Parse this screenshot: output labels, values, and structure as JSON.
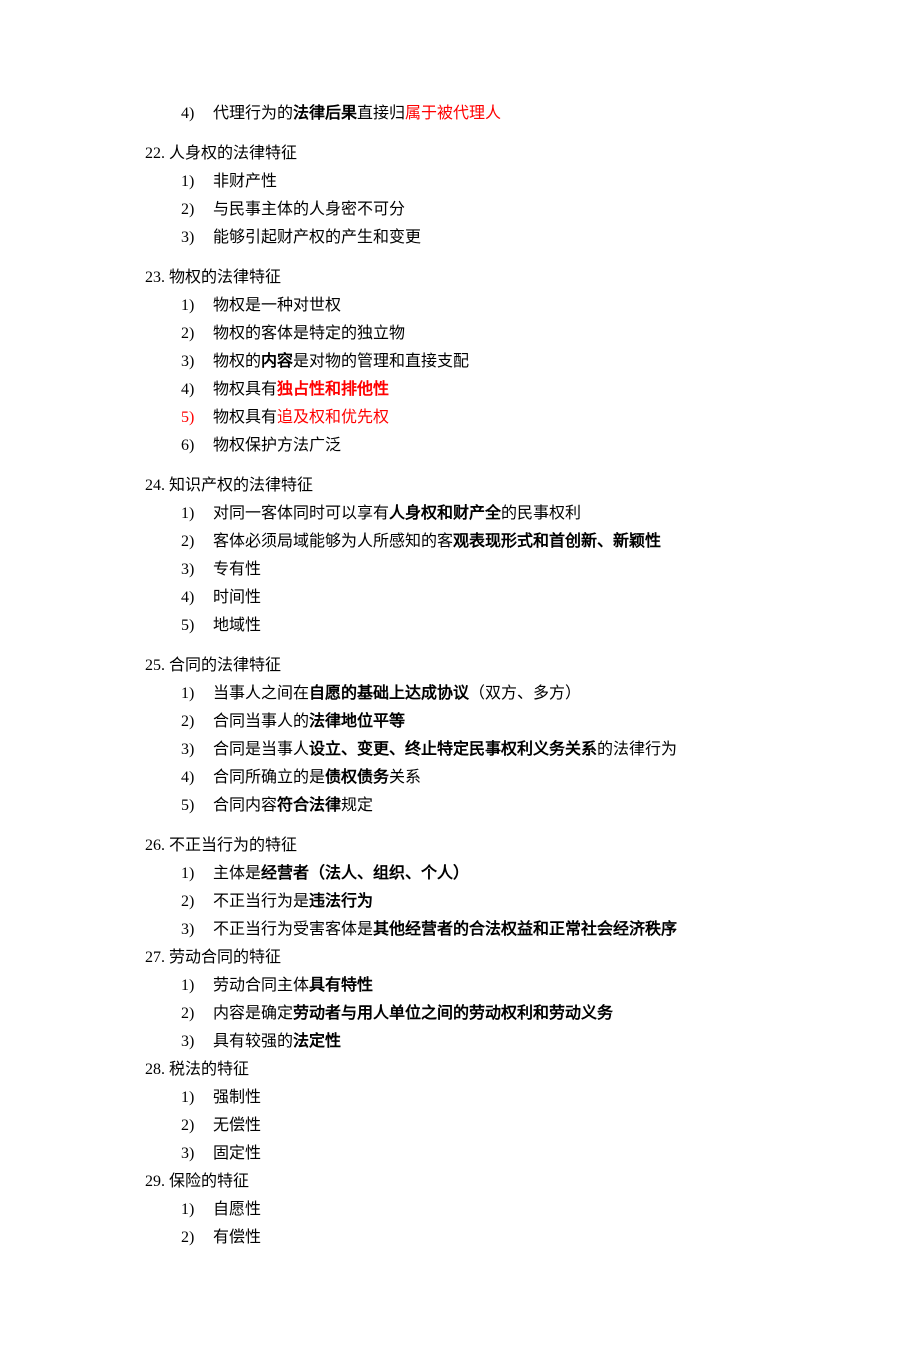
{
  "prefix": {
    "marker": "4)",
    "parts": [
      {
        "text": "代理行为的",
        "class": ""
      },
      {
        "text": "法律后果",
        "class": "bold"
      },
      {
        "text": "直接归",
        "class": ""
      },
      {
        "text": "属于被代理人",
        "class": "red"
      }
    ]
  },
  "sections": [
    {
      "num": "22.",
      "title": "人身权的法律特征",
      "title_class": "",
      "items": [
        {
          "marker": "1)",
          "parts": [
            {
              "text": "非财产性",
              "class": ""
            }
          ]
        },
        {
          "marker": "2)",
          "parts": [
            {
              "text": "与民事主体的人身密不可分",
              "class": ""
            }
          ]
        },
        {
          "marker": "3)",
          "parts": [
            {
              "text": "能够引起财产权的产生和变更",
              "class": ""
            }
          ]
        }
      ],
      "spaced": true
    },
    {
      "num": "23.",
      "title": "物权的法律特征",
      "title_class": "",
      "items": [
        {
          "marker": "1)",
          "parts": [
            {
              "text": "物权是一种对世权",
              "class": ""
            }
          ]
        },
        {
          "marker": "2)",
          "parts": [
            {
              "text": "物权的客体是特定的独立物",
              "class": ""
            }
          ]
        },
        {
          "marker": "3)",
          "parts": [
            {
              "text": "物权的",
              "class": ""
            },
            {
              "text": "内容",
              "class": "bold"
            },
            {
              "text": "是对物的管理和直接支配",
              "class": ""
            }
          ]
        },
        {
          "marker": "4)",
          "parts": [
            {
              "text": "物权具有",
              "class": ""
            },
            {
              "text": "独占性和排他性",
              "class": "bold red"
            }
          ]
        },
        {
          "marker": "5)",
          "marker_class": "red-marker",
          "parts": [
            {
              "text": "物权具有",
              "class": ""
            },
            {
              "text": "追及权和优先权",
              "class": "red"
            }
          ]
        },
        {
          "marker": "6)",
          "parts": [
            {
              "text": "物权保护方法广泛",
              "class": ""
            }
          ]
        }
      ],
      "spaced": true
    },
    {
      "num": "24.",
      "title": "知识产权的法律特征",
      "title_class": "",
      "items": [
        {
          "marker": "1)",
          "parts": [
            {
              "text": "对同一客体同时可以享有",
              "class": ""
            },
            {
              "text": "人身权和财产全",
              "class": "bold"
            },
            {
              "text": "的民事权利",
              "class": ""
            }
          ]
        },
        {
          "marker": "2)",
          "parts": [
            {
              "text": "客体必须局域能够为人所感知的客",
              "class": ""
            },
            {
              "text": "观表现形式和首创新、新颖性",
              "class": "bold"
            }
          ]
        },
        {
          "marker": "3)",
          "parts": [
            {
              "text": "专有性",
              "class": ""
            }
          ]
        },
        {
          "marker": "4)",
          "parts": [
            {
              "text": "时间性",
              "class": ""
            }
          ]
        },
        {
          "marker": "5)",
          "parts": [
            {
              "text": "地域性",
              "class": ""
            }
          ]
        }
      ],
      "spaced": true
    },
    {
      "num": "25.",
      "title": "合同的法律特征",
      "title_class": "",
      "items": [
        {
          "marker": "1)",
          "parts": [
            {
              "text": "当事人之间在",
              "class": ""
            },
            {
              "text": "自愿的基础上达成协议",
              "class": "bold"
            },
            {
              "text": "（双方、多方）",
              "class": ""
            }
          ]
        },
        {
          "marker": "2)",
          "parts": [
            {
              "text": "合同当事人的",
              "class": ""
            },
            {
              "text": "法律地位平等",
              "class": "bold"
            }
          ]
        },
        {
          "marker": "3)",
          "parts": [
            {
              "text": "合同是当事人",
              "class": ""
            },
            {
              "text": "设立、变更、终止特定民事权利义务关系",
              "class": "bold"
            },
            {
              "text": "的法律行为",
              "class": ""
            }
          ]
        },
        {
          "marker": "4)",
          "parts": [
            {
              "text": "合同所确立的是",
              "class": ""
            },
            {
              "text": "债权债务",
              "class": "bold"
            },
            {
              "text": "关系",
              "class": ""
            }
          ]
        },
        {
          "marker": "5)",
          "parts": [
            {
              "text": "合同内容",
              "class": ""
            },
            {
              "text": "符合法律",
              "class": "bold"
            },
            {
              "text": "规定",
              "class": ""
            }
          ]
        }
      ],
      "spaced": true
    },
    {
      "num": "26.",
      "title": "不正当行为的特征",
      "title_class": "",
      "items": [
        {
          "marker": "1)",
          "parts": [
            {
              "text": "主体是",
              "class": ""
            },
            {
              "text": "经营者（法人、组织、个人）",
              "class": "bold"
            }
          ]
        },
        {
          "marker": "2)",
          "parts": [
            {
              "text": "不正当行为是",
              "class": ""
            },
            {
              "text": "违法行为",
              "class": "bold"
            }
          ]
        },
        {
          "marker": "3)",
          "parts": [
            {
              "text": "不正当行为受害客体是",
              "class": ""
            },
            {
              "text": "其他经营者的合法权益和正常社会经济秩序",
              "class": "bold"
            }
          ]
        }
      ],
      "spaced": false
    },
    {
      "num": "27.",
      "title": "劳动合同的特征",
      "title_class": "",
      "items": [
        {
          "marker": "1)",
          "parts": [
            {
              "text": "劳动合同主体",
              "class": ""
            },
            {
              "text": "具有特性",
              "class": "bold"
            }
          ]
        },
        {
          "marker": "2)",
          "parts": [
            {
              "text": "内容是确定",
              "class": ""
            },
            {
              "text": "劳动者与用人单位之间的劳动权利和劳动义务",
              "class": "bold"
            }
          ]
        },
        {
          "marker": "3)",
          "parts": [
            {
              "text": "具有较强的",
              "class": ""
            },
            {
              "text": "法定性",
              "class": "bold"
            }
          ]
        }
      ],
      "spaced": false
    },
    {
      "num": "28.",
      "title": "税法的特征",
      "title_class": "",
      "items": [
        {
          "marker": "1)",
          "parts": [
            {
              "text": "强制性",
              "class": ""
            }
          ]
        },
        {
          "marker": "2)",
          "parts": [
            {
              "text": "无偿性",
              "class": ""
            }
          ]
        },
        {
          "marker": "3)",
          "parts": [
            {
              "text": "固定性",
              "class": ""
            }
          ]
        }
      ],
      "spaced": false
    },
    {
      "num": "29.",
      "title": "保险的特征",
      "title_class": "",
      "items": [
        {
          "marker": "1)",
          "parts": [
            {
              "text": "自愿性",
              "class": ""
            }
          ]
        },
        {
          "marker": "2)",
          "parts": [
            {
              "text": "有偿性",
              "class": ""
            }
          ]
        }
      ],
      "spaced": false
    }
  ]
}
